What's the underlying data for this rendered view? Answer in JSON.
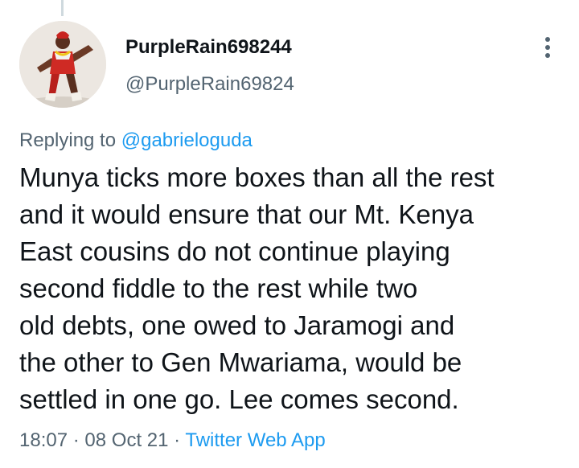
{
  "tweet": {
    "display_name": "PurpleRain698244",
    "handle": "@PurpleRain69824",
    "replying_prefix": "Replying to",
    "replying_to": "@gabrieloguda",
    "text": "Munya ticks more boxes than all the rest\nand it would ensure that our Mt. Kenya\nEast cousins do not continue playing\nsecond fiddle to the rest while two\nold debts, one owed to Jaramogi and\nthe other to Gen Mwariama, would be\nsettled in one go. Lee comes second.",
    "time": "18:07",
    "date": "08 Oct 21",
    "separator": "·",
    "source": "Twitter Web App"
  },
  "colors": {
    "primary_text": "#0f1419",
    "secondary_text": "#536471",
    "link": "#1d9bf0",
    "thread_line": "#cfd9de"
  },
  "icons": {
    "more": "more-vertical-icon"
  }
}
